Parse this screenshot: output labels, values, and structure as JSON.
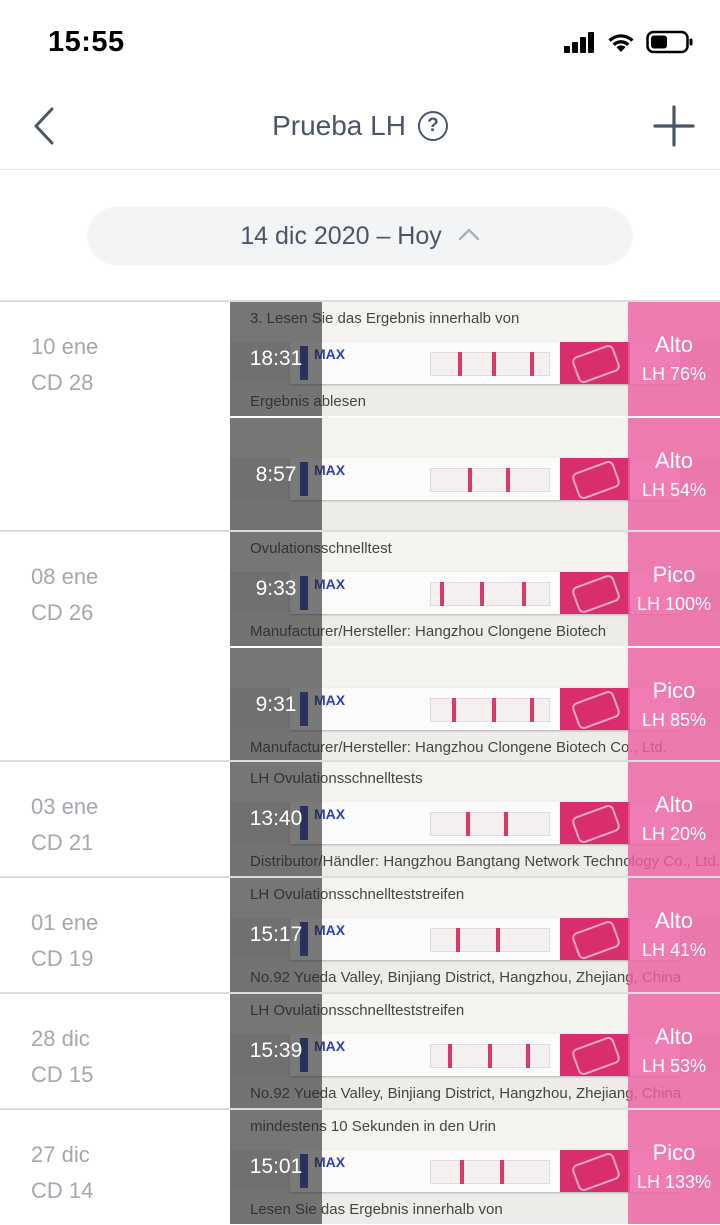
{
  "status_bar": {
    "time": "15:55"
  },
  "nav": {
    "title": "Prueba LH",
    "help_symbol": "?",
    "back_icon": "chevron-left-icon",
    "add_icon": "plus-icon"
  },
  "date_selector": {
    "label": "14 dic 2020 – Hoy",
    "icon": "chevron-up-icon"
  },
  "colors": {
    "accent_pink": "#ec60a2",
    "text_secondary": "#a3a8ae",
    "title": "#4a5666"
  },
  "days": [
    {
      "date": "10 ene",
      "cycle": "CD 28",
      "tests": [
        {
          "time": "18:31",
          "level": "Alto",
          "percent": "LH 76%",
          "photo_text_top": "3. Lesen Sie das Ergebnis innerhalb von",
          "photo_text_bottom": "Ergebnis ablesen",
          "max_label": "MAX"
        },
        {
          "time": "8:57",
          "level": "Alto",
          "percent": "LH 54%",
          "photo_text_top": "",
          "photo_text_bottom": "",
          "max_label": "MAX"
        }
      ]
    },
    {
      "date": "08 ene",
      "cycle": "CD 26",
      "tests": [
        {
          "time": "9:33",
          "level": "Pico",
          "percent": "LH 100%",
          "photo_text_top": "Ovulationsschnelltest",
          "photo_text_bottom": "Manufacturer/Hersteller: Hangzhou Clongene Biotech",
          "max_label": "MAX"
        },
        {
          "time": "9:31",
          "level": "Pico",
          "percent": "LH 85%",
          "photo_text_top": "",
          "photo_text_bottom": "Manufacturer/Hersteller: Hangzhou Clongene Biotech Co., Ltd.",
          "max_label": "MAX"
        }
      ]
    },
    {
      "date": "03 ene",
      "cycle": "CD 21",
      "tests": [
        {
          "time": "13:40",
          "level": "Alto",
          "percent": "LH 20%",
          "photo_text_top": "LH Ovulationsschnelltests",
          "photo_text_bottom": "Distributor/Händler: Hangzhou Bangtang Network Technology Co., Ltd.",
          "max_label": "MAX"
        }
      ]
    },
    {
      "date": "01 ene",
      "cycle": "CD 19",
      "tests": [
        {
          "time": "15:17",
          "level": "Alto",
          "percent": "LH 41%",
          "photo_text_top": "LH Ovulationsschnellteststreifen",
          "photo_text_bottom": "No.92 Yueda Valley, Binjiang District, Hangzhou, Zhejiang, China",
          "max_label": "MAX"
        }
      ]
    },
    {
      "date": "28 dic",
      "cycle": "CD 15",
      "tests": [
        {
          "time": "15:39",
          "level": "Alto",
          "percent": "LH 53%",
          "photo_text_top": "LH Ovulationsschnellteststreifen",
          "photo_text_bottom": "No.92 Yueda Valley, Binjiang District, Hangzhou, Zhejiang, China",
          "max_label": "MAX"
        }
      ]
    },
    {
      "date": "27 dic",
      "cycle": "CD 14",
      "tests": [
        {
          "time": "15:01",
          "level": "Pico",
          "percent": "LH 133%",
          "photo_text_top": "mindestens 10 Sekunden in den Urin",
          "photo_text_bottom": "Lesen Sie das Ergebnis innerhalb von",
          "max_label": "MAX"
        }
      ]
    }
  ]
}
